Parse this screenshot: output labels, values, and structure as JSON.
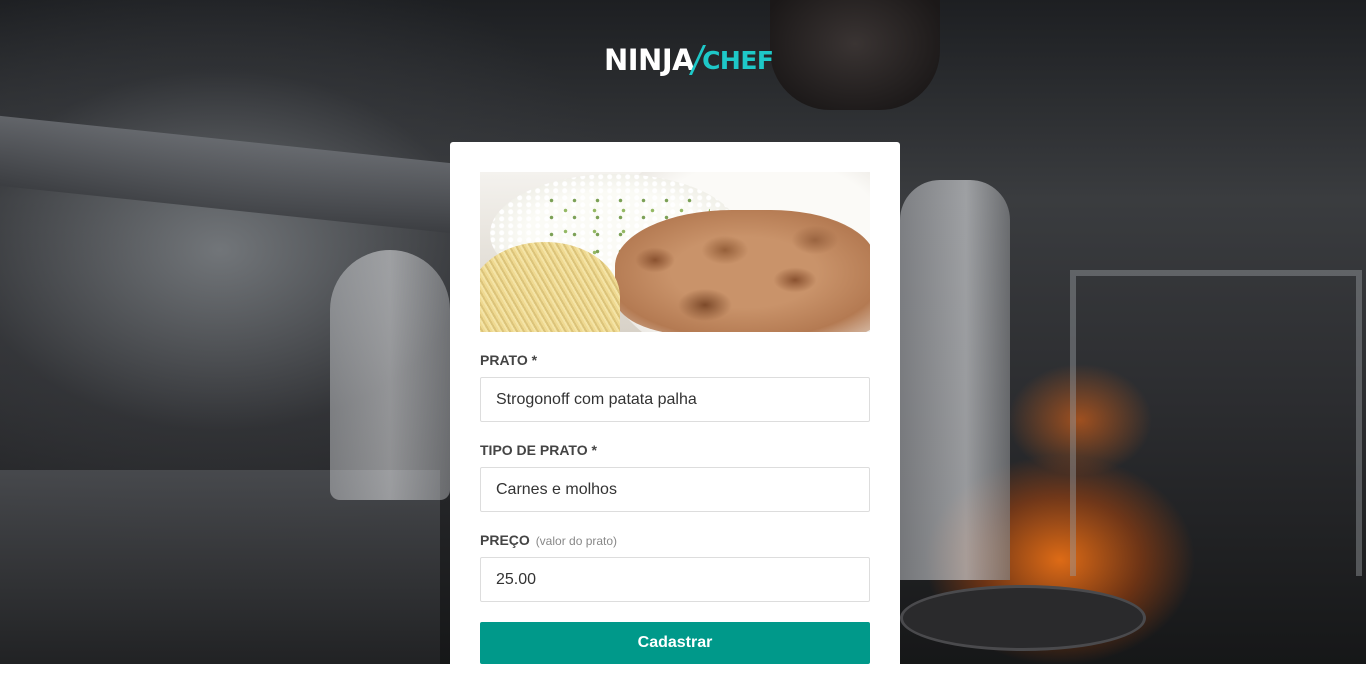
{
  "brand": {
    "logo_part1": "NINJA",
    "logo_part2": "CHEF",
    "accent_color": "#1ec8c8",
    "button_color": "#00998a"
  },
  "form": {
    "image": "dish-photo",
    "fields": [
      {
        "label": "PRATO *",
        "hint": "",
        "value": "Strogonoff com patata palha"
      },
      {
        "label": "TIPO DE PRATO *",
        "hint": "",
        "value": "Carnes e molhos"
      },
      {
        "label": "PREÇO",
        "hint": "(valor do prato)",
        "value": "25.00"
      }
    ],
    "submit_label": "Cadastrar"
  }
}
